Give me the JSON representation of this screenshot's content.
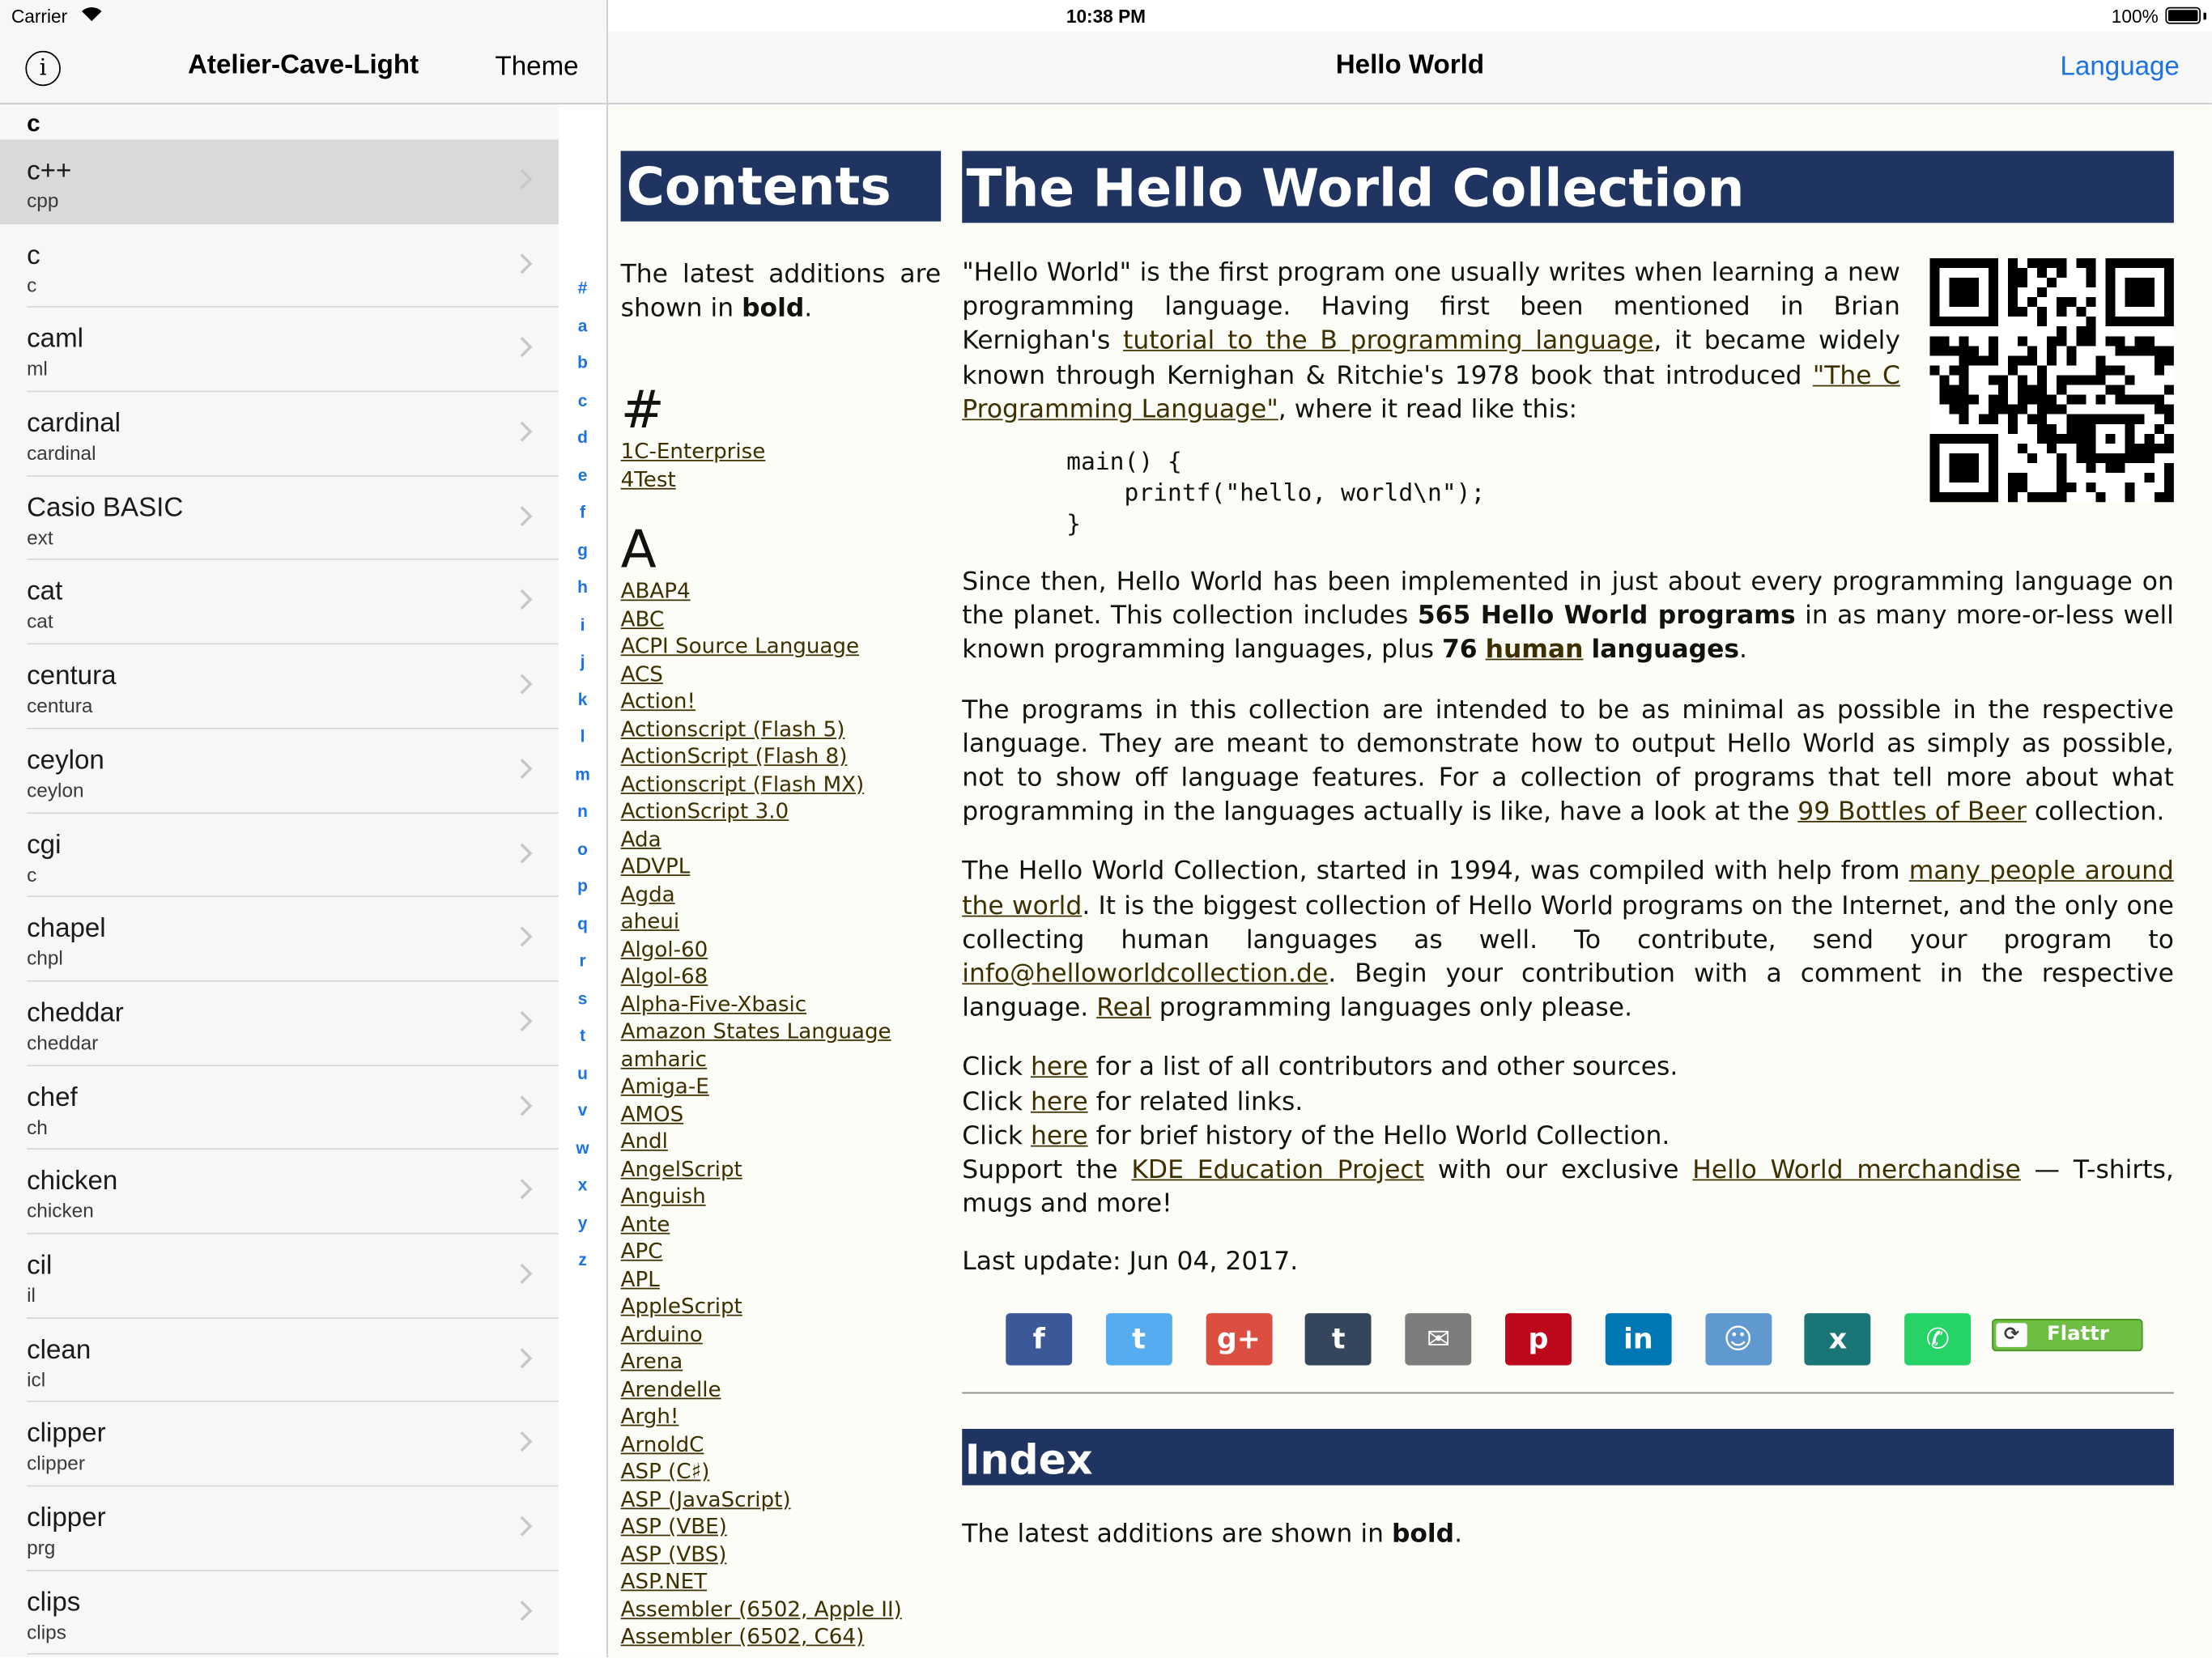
{
  "status_bar": {
    "carrier": "Carrier",
    "time": "10:38 PM",
    "battery": "100%"
  },
  "master": {
    "title": "Atelier-Cave-Light",
    "theme_label": "Theme",
    "section": "c",
    "items": [
      {
        "title": "c++",
        "subtitle": "cpp",
        "selected": true
      },
      {
        "title": "c",
        "subtitle": "c"
      },
      {
        "title": "caml",
        "subtitle": "ml"
      },
      {
        "title": "cardinal",
        "subtitle": "cardinal"
      },
      {
        "title": "Casio BASIC",
        "subtitle": "ext"
      },
      {
        "title": "cat",
        "subtitle": "cat"
      },
      {
        "title": "centura",
        "subtitle": "centura"
      },
      {
        "title": "ceylon",
        "subtitle": "ceylon"
      },
      {
        "title": "cgi",
        "subtitle": "c"
      },
      {
        "title": "chapel",
        "subtitle": "chpl"
      },
      {
        "title": "cheddar",
        "subtitle": "cheddar"
      },
      {
        "title": "chef",
        "subtitle": "ch"
      },
      {
        "title": "chicken",
        "subtitle": "chicken"
      },
      {
        "title": "cil",
        "subtitle": "il"
      },
      {
        "title": "clean",
        "subtitle": "icl"
      },
      {
        "title": "clipper",
        "subtitle": "clipper"
      },
      {
        "title": "clipper",
        "subtitle": "prg"
      },
      {
        "title": "clips",
        "subtitle": "clips"
      }
    ],
    "index_letters": [
      "#",
      "a",
      "b",
      "c",
      "d",
      "e",
      "f",
      "g",
      "h",
      "i",
      "j",
      "k",
      "l",
      "m",
      "n",
      "o",
      "p",
      "q",
      "r",
      "s",
      "t",
      "u",
      "v",
      "w",
      "x",
      "y",
      "z"
    ]
  },
  "detail": {
    "title": "Hello World",
    "language_label": "Language"
  },
  "web": {
    "contents": {
      "title": "Contents",
      "intro_pre": "The latest additions are shown in ",
      "intro_bold": "bold",
      "intro_post": ".",
      "groups": [
        {
          "letter": "#",
          "links": [
            "1C-Enterprise",
            "4Test"
          ]
        },
        {
          "letter": "A",
          "links": [
            "ABAP4",
            "ABC",
            "ACPI Source Language",
            "ACS",
            "Action!",
            "Actionscript (Flash 5)",
            "ActionScript (Flash 8)",
            "Actionscript (Flash MX)",
            "ActionScript 3.0",
            "Ada",
            "ADVPL",
            "Agda",
            "aheui",
            "Algol-60",
            "Algol-68",
            "Alpha-Five-Xbasic",
            "Amazon States Language",
            "amharic",
            "Amiga-E",
            "AMOS",
            "Andl",
            "AngelScript",
            "Anguish",
            "Ante",
            "APC",
            "APL",
            "AppleScript",
            "Arduino",
            "Arena",
            "Arendelle",
            "Argh!",
            "ArnoldC",
            "ASP (C♯)",
            "ASP (JavaScript)",
            "ASP (VBE)",
            "ASP (VBS)",
            "ASP.NET",
            "Assembler (6502, Apple II)",
            "Assembler (6502, C64)"
          ]
        }
      ]
    },
    "main": {
      "title": "The Hello World Collection",
      "p1": {
        "t1": "\"Hello World\" is the first program one usually writes when learning a new programming language. Having first been mentioned in Brian Kernighan's ",
        "l1": "tutorial to the B programming language",
        "t2": ", it became widely known through Kernighan & Ritchie's 1978 book that introduced ",
        "l2": "\"The C Programming Language\"",
        "t3": ", where it read like this:"
      },
      "code": "main() {\n    printf(\"hello, world\\n\");\n}",
      "p2": {
        "t1": "Since then, Hello World has been implemented in just about every programming language on the planet. This collection includes ",
        "b1": "565 Hello World programs",
        "t2": " in as many more-or-less well known programming languages, plus ",
        "b2": "76",
        "l1": "human",
        "b3": "languages",
        "t3": "."
      },
      "p3": {
        "t1": "The programs in this collection are intended to be as minimal as possible in the respective language. They are meant to demonstrate how to output Hello World as simply as possible, not to show off language features. For a collection of programs that tell more about what programming in the languages actually is like, have a look at the ",
        "l1": "99 Bottles of Beer",
        "t2": " collection."
      },
      "p4": {
        "t1": "The Hello World Collection, started in 1994, was compiled with help from ",
        "l1": "many people around the world",
        "t2": ". It is the biggest collection of Hello World programs on the Internet, and the only one collecting human languages as well. To contribute, send your program to ",
        "l2": "info@helloworldcollection.de",
        "t3": ". Begin your contribution with a comment in the respective language. ",
        "l3": "Real",
        "t4": " programming languages only please."
      },
      "click_lines": [
        {
          "pre": "Click ",
          "link": "here",
          "post": " for a list of all contributors and other sources."
        },
        {
          "pre": "Click ",
          "link": "here",
          "post": " for related links."
        },
        {
          "pre": "Click ",
          "link": "here",
          "post": " for brief history of the Hello World Collection."
        }
      ],
      "support": {
        "t1": "Support the ",
        "l1": "KDE Education Project",
        "t2": " with our exclusive ",
        "l2": "Hello World merchandise",
        "t3": " — T-shirts, mugs and more!"
      },
      "last_update": "Last update: Jun 04, 2017.",
      "share_buttons": [
        {
          "name": "facebook",
          "glyph": "f",
          "color": "#3b5998"
        },
        {
          "name": "twitter",
          "glyph": "t",
          "color": "#55acee"
        },
        {
          "name": "google-plus",
          "glyph": "g+",
          "color": "#dc4e41"
        },
        {
          "name": "tumblr",
          "glyph": "t",
          "color": "#35465c"
        },
        {
          "name": "email",
          "glyph": "✉",
          "color": "#7d7d7d"
        },
        {
          "name": "pinterest",
          "glyph": "p",
          "color": "#bd081c"
        },
        {
          "name": "linkedin",
          "glyph": "in",
          "color": "#0077b5"
        },
        {
          "name": "reddit",
          "glyph": "☺",
          "color": "#5f99cf"
        },
        {
          "name": "xing",
          "glyph": "x",
          "color": "#1a7576"
        },
        {
          "name": "whatsapp",
          "glyph": "✆",
          "color": "#25d366"
        }
      ],
      "flattr_label": "Flattr",
      "index_title": "Index",
      "index_intro_pre": "The latest additions are shown in ",
      "index_intro_bold": "bold",
      "index_intro_post": "."
    }
  }
}
